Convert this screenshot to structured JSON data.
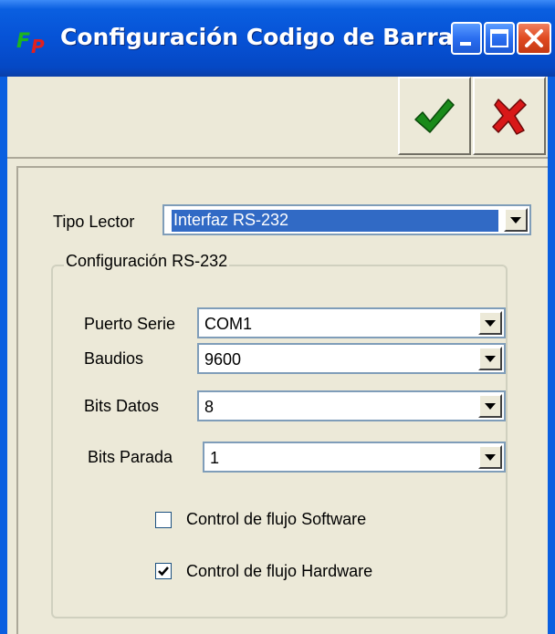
{
  "window": {
    "title": "Configuración Codigo de Barras",
    "title_color": "#ffffff",
    "titlebar_color": "#0652d6"
  },
  "toolbar": {
    "ok_icon": "checkmark-icon",
    "cancel_icon": "x-icon"
  },
  "reader": {
    "label": "Tipo Lector",
    "value": "Interfaz RS-232"
  },
  "rs232": {
    "group_title": "Configuración RS-232",
    "port_label": "Puerto Serie",
    "port_value": "COM1",
    "baud_label": "Baudios",
    "baud_value": "9600",
    "databits_label": "Bits Datos",
    "databits_value": "8",
    "stopbits_label": "Bits Parada",
    "stopbits_value": "1",
    "software_flow_label": "Control de flujo Software",
    "software_flow_checked": false,
    "hardware_flow_label": "Control de flujo Hardware",
    "hardware_flow_checked": true
  }
}
